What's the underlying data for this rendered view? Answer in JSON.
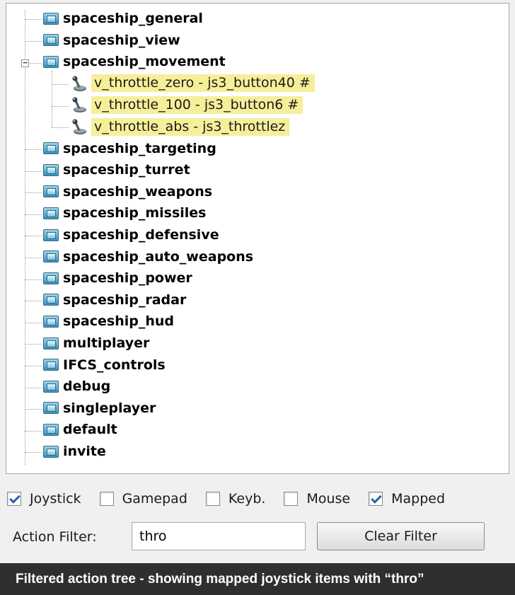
{
  "tree": {
    "nodes_before": [
      "spaceship_general",
      "spaceship_view"
    ],
    "expanded_node": "spaceship_movement",
    "actions": [
      "v_throttle_zero - js3_button40 #",
      "v_throttle_100 - js3_button6 #",
      "v_throttle_abs - js3_throttlez"
    ],
    "nodes_after": [
      "spaceship_targeting",
      "spaceship_turret",
      "spaceship_weapons",
      "spaceship_missiles",
      "spaceship_defensive",
      "spaceship_auto_weapons",
      "spaceship_power",
      "spaceship_radar",
      "spaceship_hud",
      "multiplayer",
      "IFCS_controls",
      "debug",
      "singleplayer",
      "default",
      "invite"
    ],
    "expander_symbol": "−",
    "highlight_color": "#f6ef9a"
  },
  "filters": {
    "joystick": {
      "label": "Joystick",
      "checked": true
    },
    "gamepad": {
      "label": "Gamepad",
      "checked": false
    },
    "keyboard": {
      "label": "Keyb.",
      "checked": false
    },
    "mouse": {
      "label": "Mouse",
      "checked": false
    },
    "mapped": {
      "label": "Mapped",
      "checked": true
    }
  },
  "action_filter": {
    "label": "Action Filter:",
    "value": "thro"
  },
  "clear_button": {
    "label": "Clear Filter"
  },
  "caption": "Filtered action tree - showing mapped joystick items with “thro”"
}
